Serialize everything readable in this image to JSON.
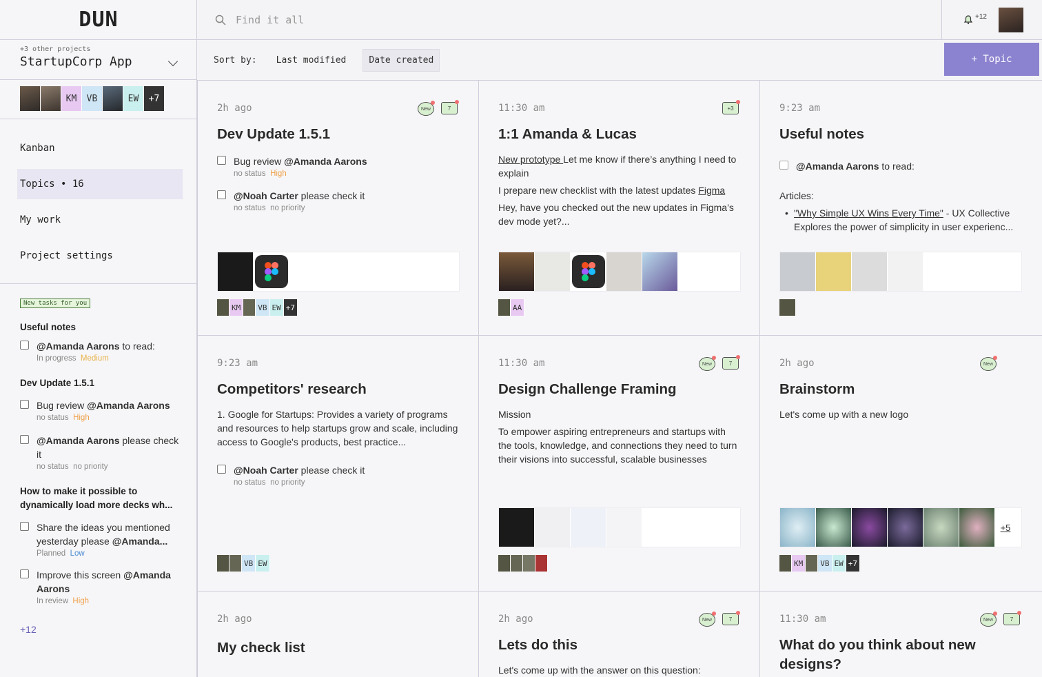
{
  "app": {
    "logo": "DUN"
  },
  "project": {
    "other": "+3 other projects",
    "name": "StartupCorp App"
  },
  "team": {
    "initials": [
      "KM",
      "VB",
      "EW"
    ],
    "more": "+7"
  },
  "nav": {
    "kanban": "Kanban",
    "topics": "Topics • 16",
    "mywork": "My work",
    "settings": "Project settings"
  },
  "sidebar": {
    "new_tag": "New tasks for you",
    "sections": [
      {
        "title": "Useful notes"
      },
      {
        "title": "Dev Update 1.5.1"
      },
      {
        "title": "How to make it possible to dynamically load more decks wh..."
      }
    ],
    "tasks": [
      {
        "mention": "@Amanda Aarons",
        "text": " to read:",
        "status": "In progress",
        "priority": "Medium"
      },
      {
        "pre": "Bug review ",
        "mention": "@Amanda Aarons",
        "status": "no status",
        "priority": "High"
      },
      {
        "mention": "@Amanda Aarons",
        "text": " please check it",
        "status": "no status",
        "priority": "no priority"
      },
      {
        "pre": "Share the ideas you mentioned yesterday please ",
        "mention": "@Amanda...",
        "status": "Planned",
        "priority": "Low"
      },
      {
        "pre": "Improve this screen ",
        "mention": "@Amanda Aarons",
        "status": "In review",
        "priority": "High"
      }
    ],
    "more": "+12"
  },
  "search": {
    "placeholder": "Find it all"
  },
  "user": {
    "notif_count": "+12"
  },
  "sort": {
    "label": "Sort by:",
    "opt1": "Last modified",
    "opt2": "Date created"
  },
  "topic_button": "+ Topic",
  "cards": {
    "c1": {
      "time": "2h ago",
      "title": "Dev Update 1.5.1",
      "t1_pre": "Bug review ",
      "t1_mention": "@Amanda Aarons",
      "t1_status": "no status",
      "t1_priority": "High",
      "t2_mention": "@Noah Carter",
      "t2_text": " please check it",
      "t2_status": "no status",
      "t2_priority": "no priority",
      "avatars": [
        "KM",
        "VB",
        "EW"
      ],
      "more": "+7",
      "badge_new": "New",
      "comments": "7"
    },
    "c2": {
      "time": "11:30 am",
      "title": "1:1  Amanda & Lucas",
      "p1_link": "New prototype ",
      "p1_text": "Let me know if there’s anything I need to explain",
      "p2_text": "I prepare new checklist with the latest updates ",
      "p2_link": "Figma",
      "p3": "Hey, have you checked out the new updates in Figma’s dev mode yet?...",
      "avatars": [
        "AA"
      ],
      "comments": "+3"
    },
    "c3": {
      "time": "9:23 am",
      "title": "Useful notes",
      "t1_mention": "@Amanda Aarons",
      "t1_text": " to read:",
      "articles": "Articles:",
      "a_link": "\"Why Simple UX Wins Every Time\"",
      "a_text": " - UX Collective",
      "a_desc": "Explores the power of simplicity in user experienc..."
    },
    "c4": {
      "time": "9:23 am",
      "title": "Competitors' research",
      "body": "1. Google for Startups: Provides a variety of programs and resources to help startups grow and scale, including access to Google's products, best practice...",
      "t1_mention": "@Noah Carter",
      "t1_text": " please check it",
      "t1_status": "no status",
      "t1_priority": "no priority",
      "avatars": [
        "VB",
        "EW"
      ]
    },
    "c5": {
      "time": "11:30 am",
      "title": "Design Challenge Framing",
      "body1": "Mission",
      "body2": "To empower aspiring entrepreneurs and startups with the tools, knowledge, and connections they need to turn their visions into successful, scalable businesses",
      "badge_new": "New",
      "comments": "7"
    },
    "c6": {
      "time": "2h ago",
      "title": "Brainstorm",
      "body": "Let's come up with a new logo",
      "img_more": "+5",
      "avatars": [
        "KM",
        "VB",
        "EW"
      ],
      "more": "+7",
      "badge_new": "New"
    },
    "c7": {
      "time": "2h ago",
      "title": "My check list"
    },
    "c8": {
      "time": "2h ago",
      "title": "Lets do this",
      "body": "Let's come up with the answer on this question:",
      "badge_new": "New",
      "comments": "7"
    },
    "c9": {
      "time": "11:30 am",
      "title": "What do you think about new designs?",
      "badge_new": "New",
      "comments": "7"
    }
  },
  "colors": {
    "accent": "#8b83cf",
    "high": "#f0a04a",
    "low": "#4a8ad0",
    "nav_active": "#e7e6f2"
  }
}
